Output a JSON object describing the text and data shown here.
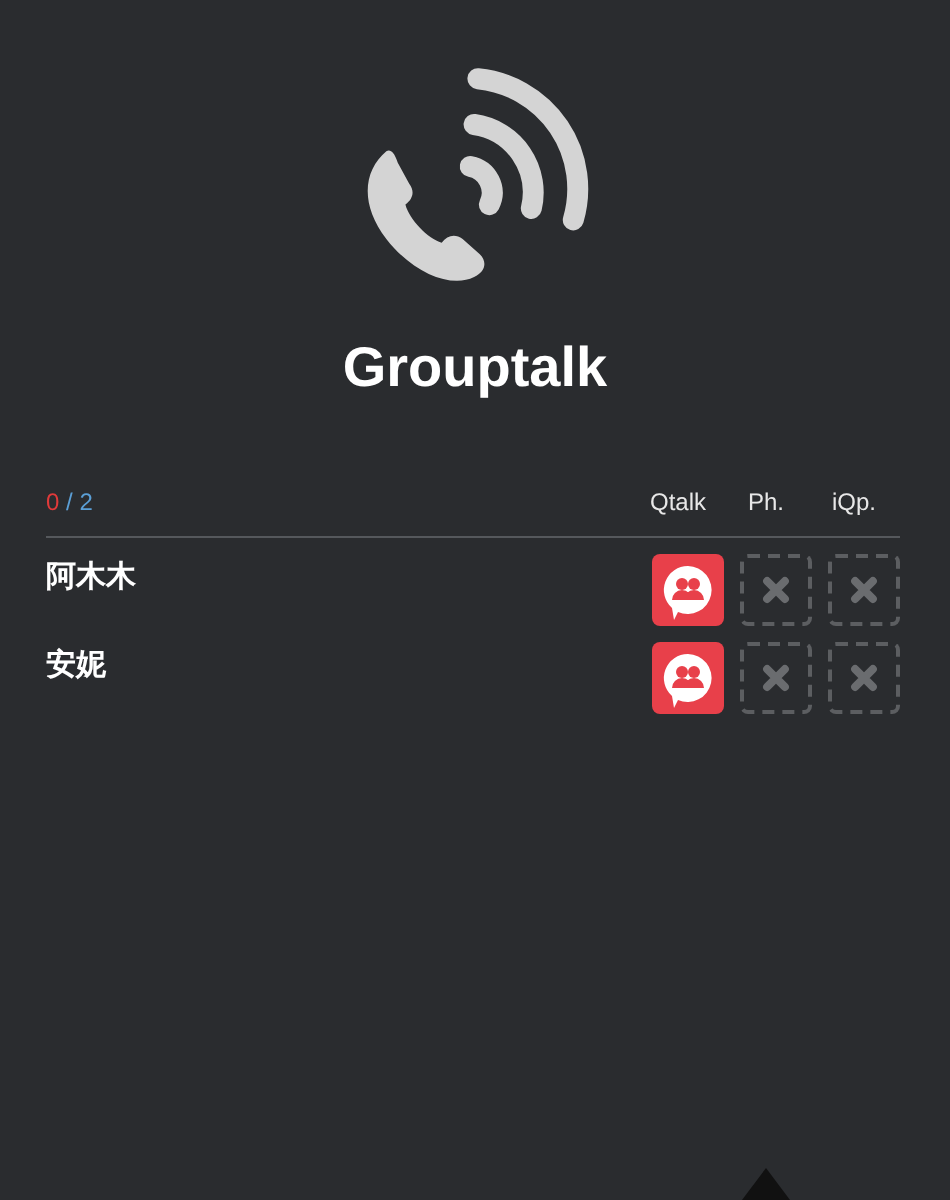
{
  "app": {
    "title": "Grouptalk"
  },
  "counter": {
    "online": "0",
    "separator": "/",
    "total": "2"
  },
  "columns": [
    "Qtalk",
    "Ph.",
    "iQp."
  ],
  "members": [
    {
      "name": "阿木木",
      "channels": [
        {
          "available": true
        },
        {
          "available": false
        },
        {
          "available": false
        }
      ]
    },
    {
      "name": "安妮",
      "channels": [
        {
          "available": true
        },
        {
          "available": false
        },
        {
          "available": false
        }
      ]
    }
  ]
}
